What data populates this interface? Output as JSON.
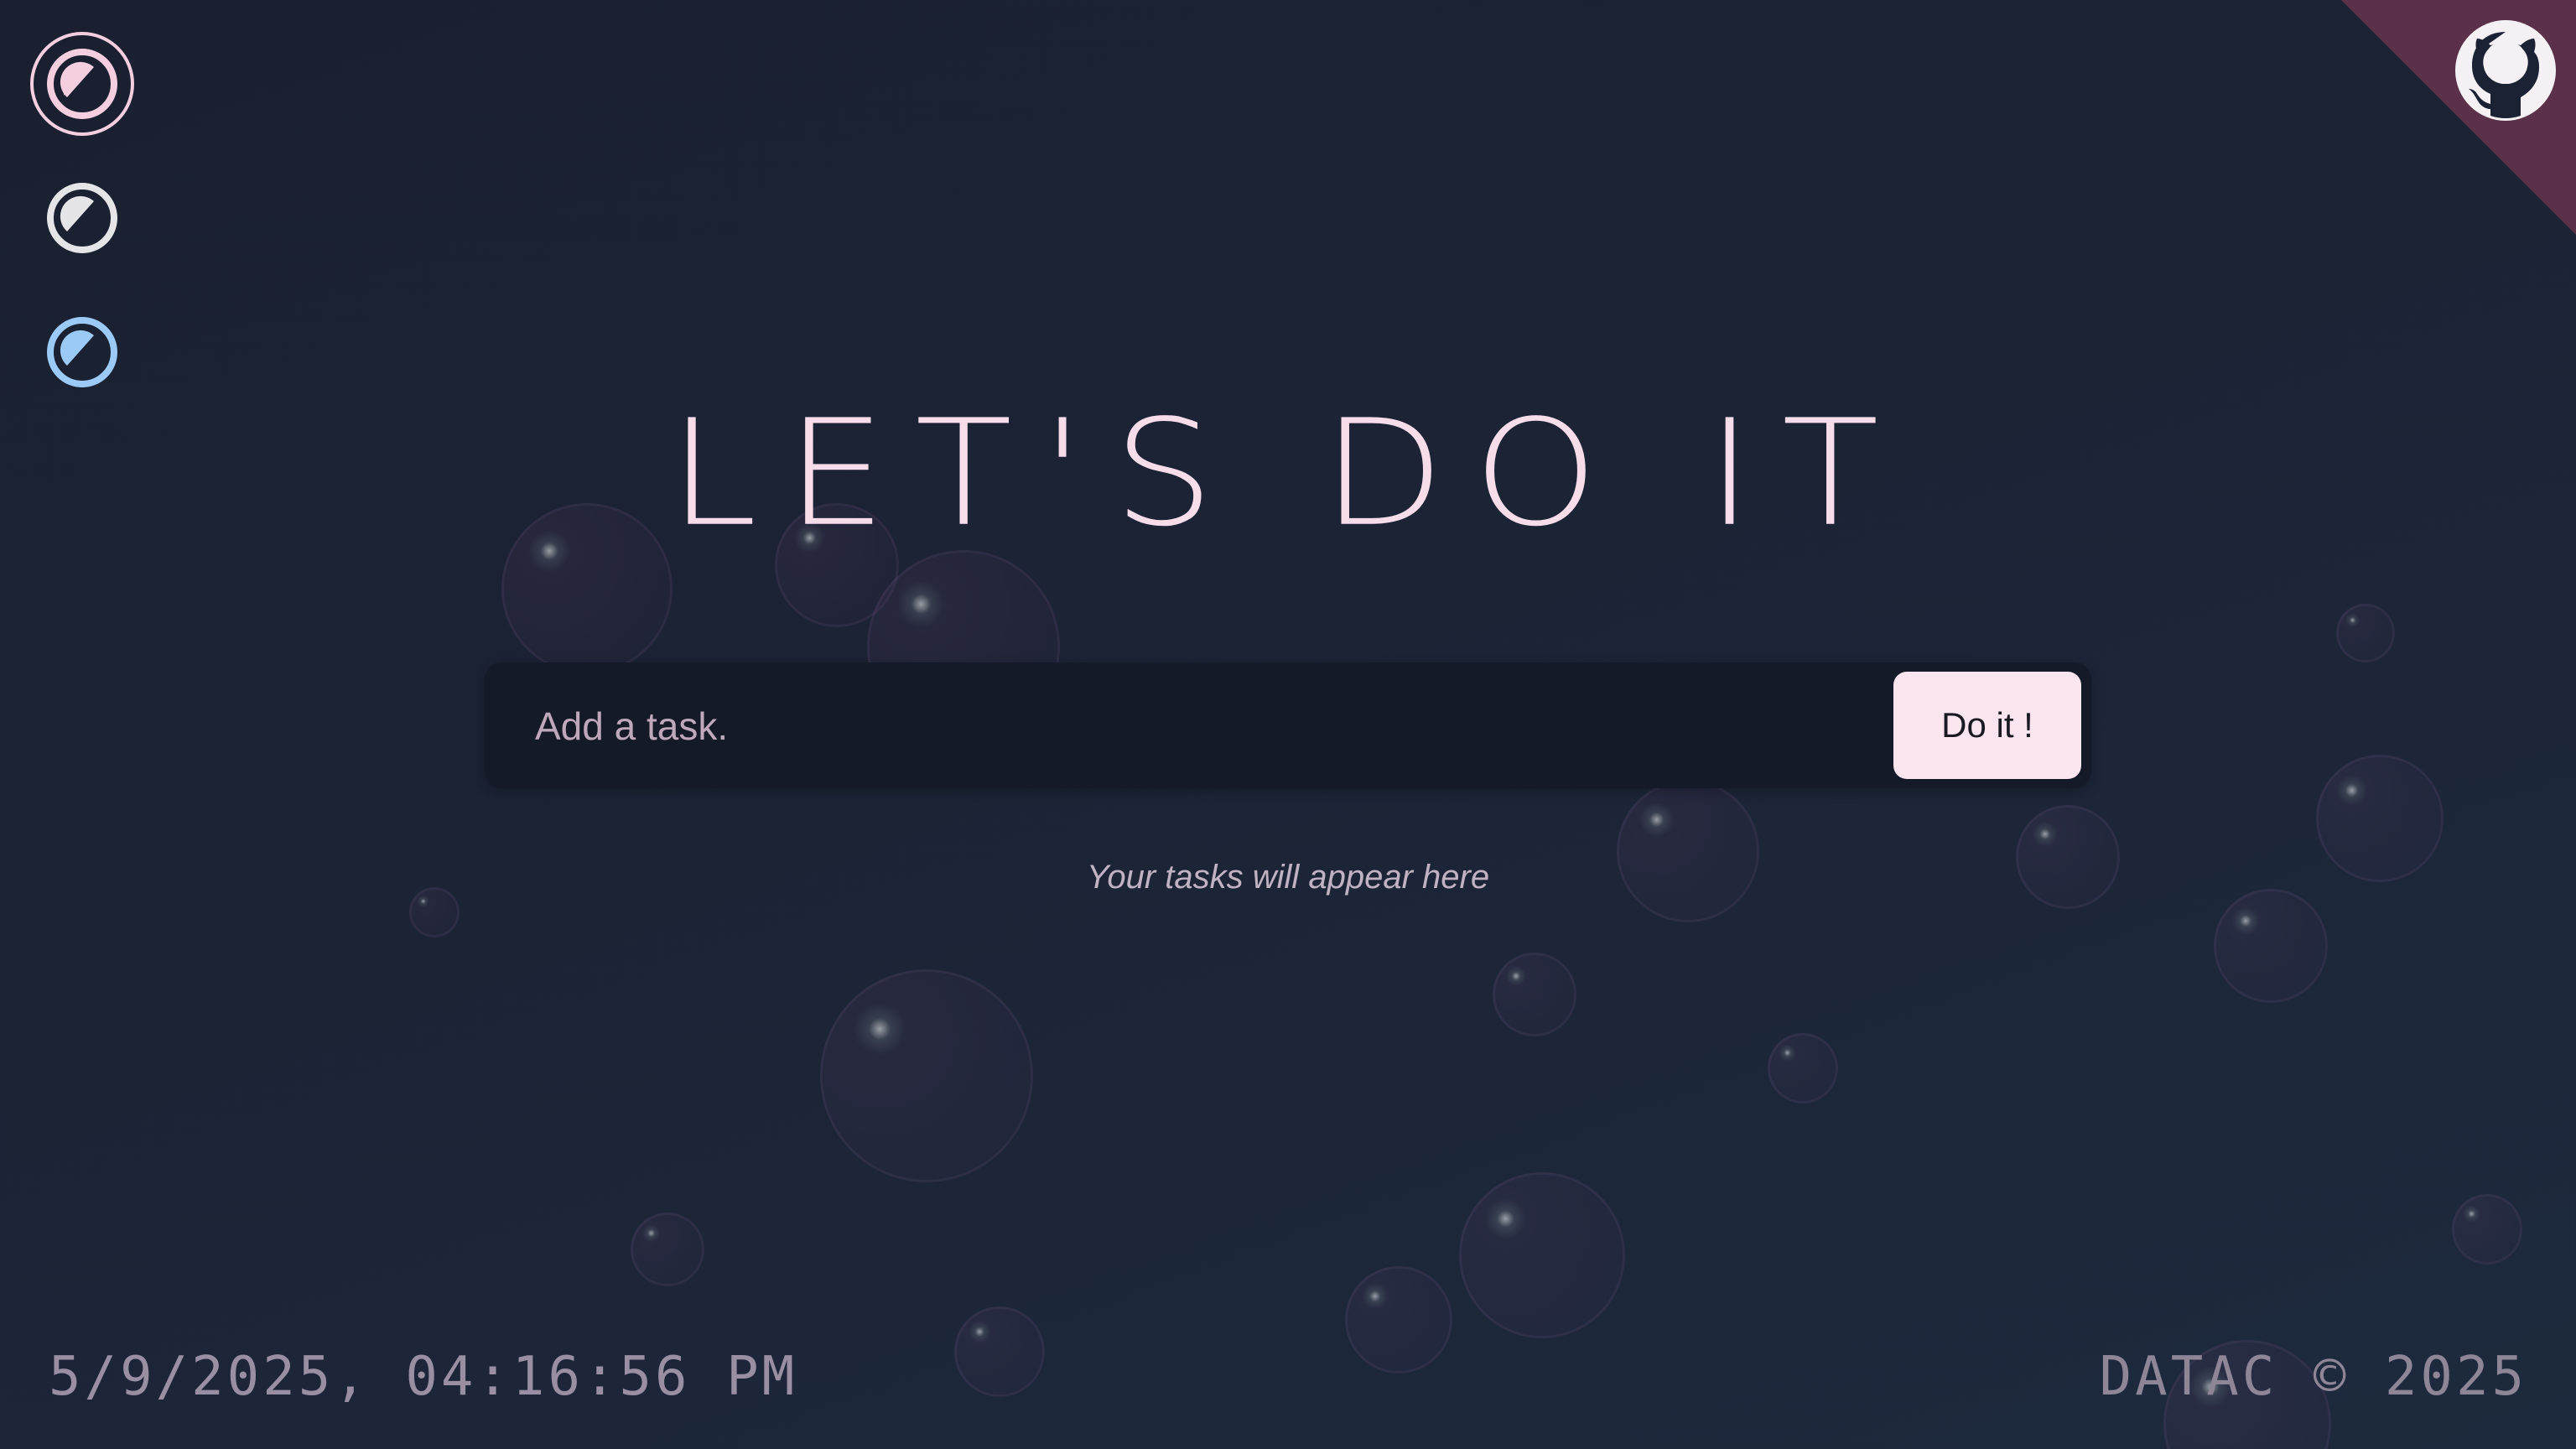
{
  "themes": [
    {
      "name": "pink",
      "color": "#f5cfe0",
      "active": true
    },
    {
      "name": "gray",
      "color": "#e5e5e8",
      "active": false
    },
    {
      "name": "blue",
      "color": "#9ccaf7",
      "active": false
    }
  ],
  "corner": {
    "icon": "github-icon",
    "color": "#5a3148"
  },
  "header": {
    "title": "LET'S DO IT"
  },
  "task_form": {
    "placeholder": "Add a task.",
    "submit_label": "Do it !"
  },
  "tasks": {
    "empty_message": "Your tasks will appear here"
  },
  "footer": {
    "datetime": "5/9/2025, 04:16:56 PM",
    "copyright": "DATAC © 2025"
  }
}
